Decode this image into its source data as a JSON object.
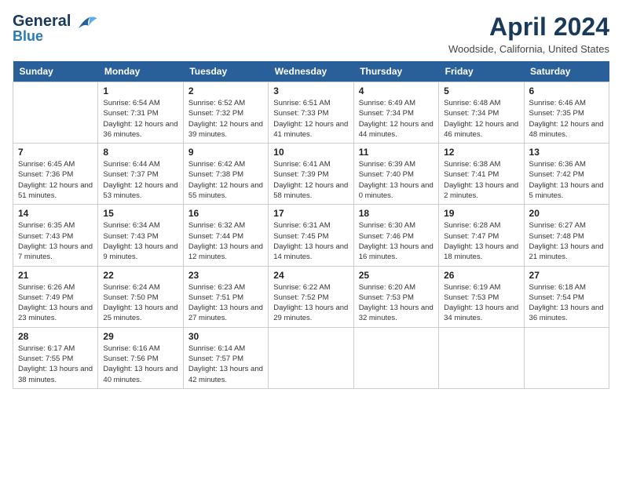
{
  "header": {
    "logo_line1": "General",
    "logo_line2": "Blue",
    "month": "April 2024",
    "location": "Woodside, California, United States"
  },
  "weekdays": [
    "Sunday",
    "Monday",
    "Tuesday",
    "Wednesday",
    "Thursday",
    "Friday",
    "Saturday"
  ],
  "weeks": [
    [
      {
        "day": "",
        "sunrise": "",
        "sunset": "",
        "daylight": ""
      },
      {
        "day": "1",
        "sunrise": "Sunrise: 6:54 AM",
        "sunset": "Sunset: 7:31 PM",
        "daylight": "Daylight: 12 hours and 36 minutes."
      },
      {
        "day": "2",
        "sunrise": "Sunrise: 6:52 AM",
        "sunset": "Sunset: 7:32 PM",
        "daylight": "Daylight: 12 hours and 39 minutes."
      },
      {
        "day": "3",
        "sunrise": "Sunrise: 6:51 AM",
        "sunset": "Sunset: 7:33 PM",
        "daylight": "Daylight: 12 hours and 41 minutes."
      },
      {
        "day": "4",
        "sunrise": "Sunrise: 6:49 AM",
        "sunset": "Sunset: 7:34 PM",
        "daylight": "Daylight: 12 hours and 44 minutes."
      },
      {
        "day": "5",
        "sunrise": "Sunrise: 6:48 AM",
        "sunset": "Sunset: 7:34 PM",
        "daylight": "Daylight: 12 hours and 46 minutes."
      },
      {
        "day": "6",
        "sunrise": "Sunrise: 6:46 AM",
        "sunset": "Sunset: 7:35 PM",
        "daylight": "Daylight: 12 hours and 48 minutes."
      }
    ],
    [
      {
        "day": "7",
        "sunrise": "Sunrise: 6:45 AM",
        "sunset": "Sunset: 7:36 PM",
        "daylight": "Daylight: 12 hours and 51 minutes."
      },
      {
        "day": "8",
        "sunrise": "Sunrise: 6:44 AM",
        "sunset": "Sunset: 7:37 PM",
        "daylight": "Daylight: 12 hours and 53 minutes."
      },
      {
        "day": "9",
        "sunrise": "Sunrise: 6:42 AM",
        "sunset": "Sunset: 7:38 PM",
        "daylight": "Daylight: 12 hours and 55 minutes."
      },
      {
        "day": "10",
        "sunrise": "Sunrise: 6:41 AM",
        "sunset": "Sunset: 7:39 PM",
        "daylight": "Daylight: 12 hours and 58 minutes."
      },
      {
        "day": "11",
        "sunrise": "Sunrise: 6:39 AM",
        "sunset": "Sunset: 7:40 PM",
        "daylight": "Daylight: 13 hours and 0 minutes."
      },
      {
        "day": "12",
        "sunrise": "Sunrise: 6:38 AM",
        "sunset": "Sunset: 7:41 PM",
        "daylight": "Daylight: 13 hours and 2 minutes."
      },
      {
        "day": "13",
        "sunrise": "Sunrise: 6:36 AM",
        "sunset": "Sunset: 7:42 PM",
        "daylight": "Daylight: 13 hours and 5 minutes."
      }
    ],
    [
      {
        "day": "14",
        "sunrise": "Sunrise: 6:35 AM",
        "sunset": "Sunset: 7:43 PM",
        "daylight": "Daylight: 13 hours and 7 minutes."
      },
      {
        "day": "15",
        "sunrise": "Sunrise: 6:34 AM",
        "sunset": "Sunset: 7:43 PM",
        "daylight": "Daylight: 13 hours and 9 minutes."
      },
      {
        "day": "16",
        "sunrise": "Sunrise: 6:32 AM",
        "sunset": "Sunset: 7:44 PM",
        "daylight": "Daylight: 13 hours and 12 minutes."
      },
      {
        "day": "17",
        "sunrise": "Sunrise: 6:31 AM",
        "sunset": "Sunset: 7:45 PM",
        "daylight": "Daylight: 13 hours and 14 minutes."
      },
      {
        "day": "18",
        "sunrise": "Sunrise: 6:30 AM",
        "sunset": "Sunset: 7:46 PM",
        "daylight": "Daylight: 13 hours and 16 minutes."
      },
      {
        "day": "19",
        "sunrise": "Sunrise: 6:28 AM",
        "sunset": "Sunset: 7:47 PM",
        "daylight": "Daylight: 13 hours and 18 minutes."
      },
      {
        "day": "20",
        "sunrise": "Sunrise: 6:27 AM",
        "sunset": "Sunset: 7:48 PM",
        "daylight": "Daylight: 13 hours and 21 minutes."
      }
    ],
    [
      {
        "day": "21",
        "sunrise": "Sunrise: 6:26 AM",
        "sunset": "Sunset: 7:49 PM",
        "daylight": "Daylight: 13 hours and 23 minutes."
      },
      {
        "day": "22",
        "sunrise": "Sunrise: 6:24 AM",
        "sunset": "Sunset: 7:50 PM",
        "daylight": "Daylight: 13 hours and 25 minutes."
      },
      {
        "day": "23",
        "sunrise": "Sunrise: 6:23 AM",
        "sunset": "Sunset: 7:51 PM",
        "daylight": "Daylight: 13 hours and 27 minutes."
      },
      {
        "day": "24",
        "sunrise": "Sunrise: 6:22 AM",
        "sunset": "Sunset: 7:52 PM",
        "daylight": "Daylight: 13 hours and 29 minutes."
      },
      {
        "day": "25",
        "sunrise": "Sunrise: 6:20 AM",
        "sunset": "Sunset: 7:53 PM",
        "daylight": "Daylight: 13 hours and 32 minutes."
      },
      {
        "day": "26",
        "sunrise": "Sunrise: 6:19 AM",
        "sunset": "Sunset: 7:53 PM",
        "daylight": "Daylight: 13 hours and 34 minutes."
      },
      {
        "day": "27",
        "sunrise": "Sunrise: 6:18 AM",
        "sunset": "Sunset: 7:54 PM",
        "daylight": "Daylight: 13 hours and 36 minutes."
      }
    ],
    [
      {
        "day": "28",
        "sunrise": "Sunrise: 6:17 AM",
        "sunset": "Sunset: 7:55 PM",
        "daylight": "Daylight: 13 hours and 38 minutes."
      },
      {
        "day": "29",
        "sunrise": "Sunrise: 6:16 AM",
        "sunset": "Sunset: 7:56 PM",
        "daylight": "Daylight: 13 hours and 40 minutes."
      },
      {
        "day": "30",
        "sunrise": "Sunrise: 6:14 AM",
        "sunset": "Sunset: 7:57 PM",
        "daylight": "Daylight: 13 hours and 42 minutes."
      },
      {
        "day": "",
        "sunrise": "",
        "sunset": "",
        "daylight": ""
      },
      {
        "day": "",
        "sunrise": "",
        "sunset": "",
        "daylight": ""
      },
      {
        "day": "",
        "sunrise": "",
        "sunset": "",
        "daylight": ""
      },
      {
        "day": "",
        "sunrise": "",
        "sunset": "",
        "daylight": ""
      }
    ]
  ]
}
